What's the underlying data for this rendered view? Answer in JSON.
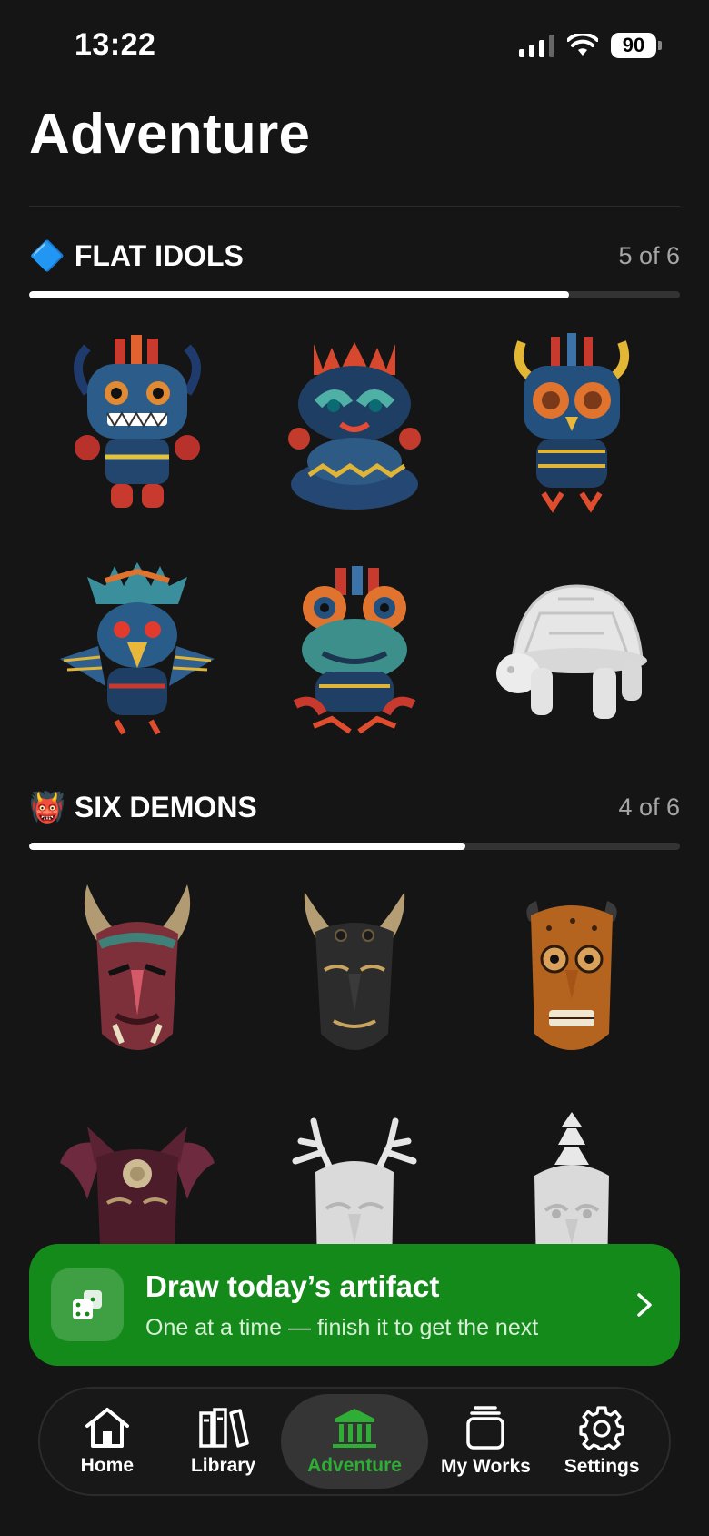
{
  "status": {
    "time": "13:22",
    "battery": "90"
  },
  "page": {
    "title": "Adventure"
  },
  "collections": [
    {
      "emoji": "🔷",
      "name": "FLAT IDOLS",
      "count": "5 of 6",
      "progress": 0.83,
      "items": [
        "idol-demon",
        "idol-serpent",
        "idol-owl",
        "idol-eagle",
        "idol-frog",
        "idol-turtle-locked"
      ]
    },
    {
      "emoji": "👹",
      "name": "SIX DEMONS",
      "count": "4 of 6",
      "progress": 0.67,
      "items": [
        "mask-red-oni",
        "mask-black-oni",
        "mask-orange-oni",
        "mask-winged",
        "mask-antlered-locked",
        "mask-crested-locked"
      ]
    }
  ],
  "cta": {
    "title": "Draw today’s artifact",
    "subtitle": "One at a time — finish it to get the next",
    "icon": "dice-icon",
    "color": "#148a1a"
  },
  "tabs": [
    {
      "label": "Home",
      "icon": "home-icon",
      "active": false
    },
    {
      "label": "Library",
      "icon": "library-icon",
      "active": false
    },
    {
      "label": "Adventure",
      "icon": "museum-icon",
      "active": true
    },
    {
      "label": "My Works",
      "icon": "works-icon",
      "active": false
    },
    {
      "label": "Settings",
      "icon": "gear-icon",
      "active": false
    }
  ],
  "colors": {
    "background": "#151515",
    "accent": "#2fae35",
    "cta": "#148a1a"
  }
}
